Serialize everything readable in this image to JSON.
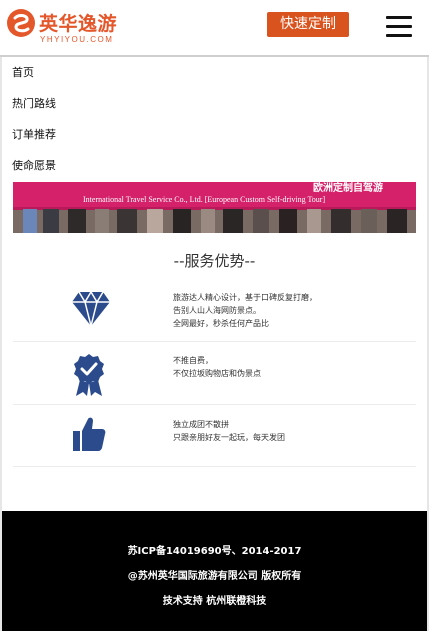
{
  "header": {
    "logo_cn": "英华逸游",
    "logo_en": "YHYIYOU.COM",
    "cta_label": "快速定制"
  },
  "nav": {
    "items": [
      {
        "label": "首页"
      },
      {
        "label": "热门路线"
      },
      {
        "label": "订单推荐"
      },
      {
        "label": "使命愿景"
      }
    ]
  },
  "banner": {
    "text_line1": "International Travel Service Co., Ltd. [European Custom Self-driving Tour]",
    "text_line2": "欧洲定制自驾游"
  },
  "services": {
    "title": "--服务优势--",
    "items": [
      {
        "icon": "diamond-icon",
        "lines": [
          "旅游达人精心设计，基于口碑反复打磨，",
          "告别人山人海网防景点。",
          "全网最好，秒杀任何产品比"
        ]
      },
      {
        "icon": "badge-check-icon",
        "lines": [
          "不推自费，",
          "不仅拉坂购物店和伪景点"
        ]
      },
      {
        "icon": "thumbs-up-icon",
        "lines": [
          "独立成团不散拼",
          "只跟亲朋好友一起玩，每天发团"
        ]
      }
    ]
  },
  "footer": {
    "icp": "苏ICP备14019690号、2014-2017",
    "copyright": "@苏州英华国际旅游有限公司 版权所有",
    "support": "技术支持 杭州联橙科技"
  },
  "colors": {
    "brand": "#e4572b",
    "cta": "#d9531e",
    "icon_blue": "#2b4b8c",
    "footer_bg": "#000000"
  }
}
